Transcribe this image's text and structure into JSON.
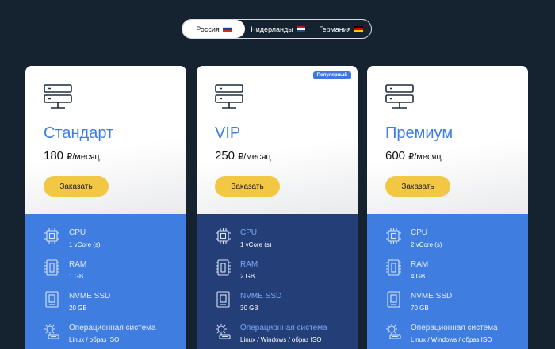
{
  "location_tabs": [
    {
      "label": "Россия",
      "flag": "russia-flag-icon",
      "active": true
    },
    {
      "label": "Нидерланды",
      "flag": "netherlands-flag-icon",
      "active": false
    },
    {
      "label": "Германия",
      "flag": "germany-flag-icon",
      "active": false
    }
  ],
  "plans": [
    {
      "name": "Стандарт",
      "price": "180",
      "price_unit": "₽/месяц",
      "button": "Заказать",
      "badge": "",
      "specs": [
        {
          "title": "CPU",
          "value": "1 vCore (s)",
          "icon": "cpu-icon"
        },
        {
          "title": "RAM",
          "value": "1 GB",
          "icon": "ram-icon"
        },
        {
          "title": "NVME SSD",
          "value": "20 GB",
          "icon": "ssd-icon"
        },
        {
          "title": "Операционная система",
          "value": "Linux / образ ISO",
          "icon": "os-icon"
        }
      ]
    },
    {
      "name": "VIP",
      "price": "250",
      "price_unit": "₽/месяц",
      "button": "Заказать",
      "badge": "Популярный",
      "specs": [
        {
          "title": "CPU",
          "value": "1 vCore (s)",
          "icon": "cpu-icon"
        },
        {
          "title": "RAM",
          "value": "2 GB",
          "icon": "ram-icon"
        },
        {
          "title": "NVME SSD",
          "value": "30 GB",
          "icon": "ssd-icon"
        },
        {
          "title": "Операционная система",
          "value": "Linux / Windows / образ ISO",
          "icon": "os-icon"
        }
      ]
    },
    {
      "name": "Премиум",
      "price": "600",
      "price_unit": "₽/месяц",
      "button": "Заказать",
      "badge": "",
      "specs": [
        {
          "title": "CPU",
          "value": "2 vCore (s)",
          "icon": "cpu-icon"
        },
        {
          "title": "RAM",
          "value": "4 GB",
          "icon": "ram-icon"
        },
        {
          "title": "NVME SSD",
          "value": "70 GB",
          "icon": "ssd-icon"
        },
        {
          "title": "Операционная система",
          "value": "Linux / Windows / образ ISO",
          "icon": "os-icon"
        }
      ]
    }
  ],
  "colors": {
    "background": "#152230",
    "accent": "#3e7fe3",
    "button": "#f2c744",
    "spec_panel": "#3f7ee0",
    "spec_panel_featured": "#243f78"
  }
}
